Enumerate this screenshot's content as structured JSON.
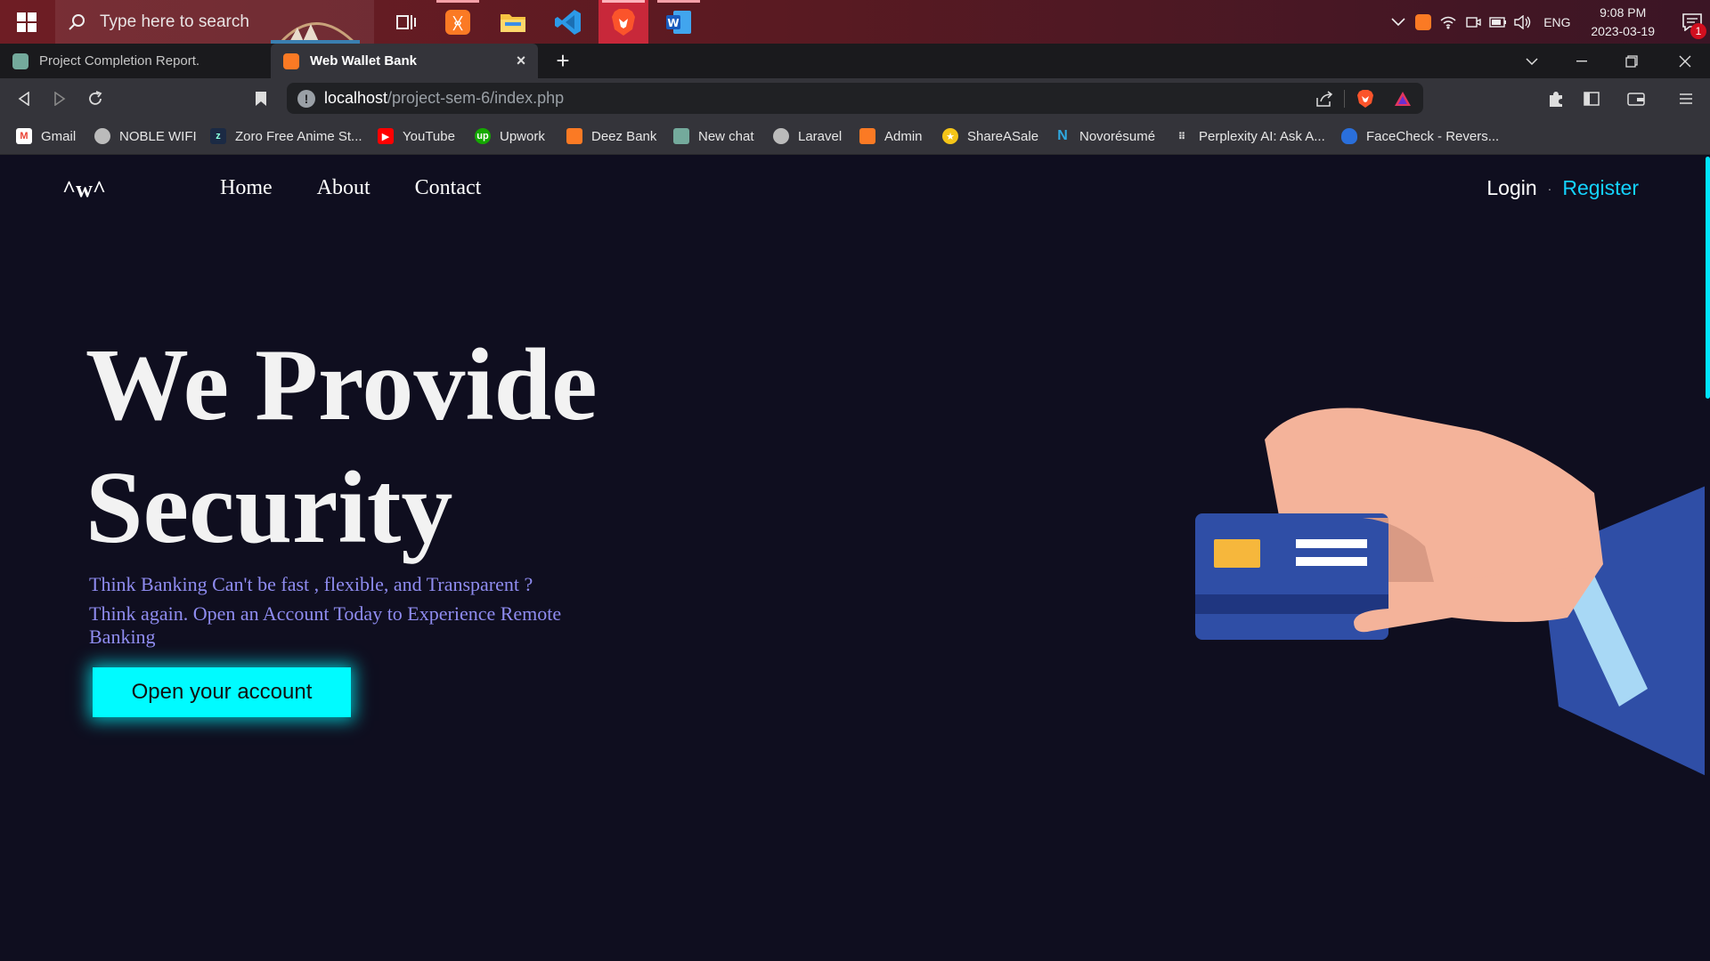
{
  "taskbar": {
    "search_placeholder": "Type here to search",
    "language": "ENG",
    "time": "9:08 PM",
    "date": "2023-03-19",
    "notification_count": "1"
  },
  "browser": {
    "tabs": [
      {
        "title": "Project Completion Report."
      },
      {
        "title": "Web Wallet Bank"
      }
    ],
    "url_host": "localhost",
    "url_path": "/project-sem-6/index.php",
    "bookmarks": [
      {
        "label": "Gmail"
      },
      {
        "label": "NOBLE WIFI"
      },
      {
        "label": "Zoro Free Anime St..."
      },
      {
        "label": "YouTube"
      },
      {
        "label": "Upwork"
      },
      {
        "label": "Deez Bank"
      },
      {
        "label": "New chat"
      },
      {
        "label": "Laravel"
      },
      {
        "label": "Admin"
      },
      {
        "label": "ShareASale"
      },
      {
        "label": "Novorésumé"
      },
      {
        "label": "Perplexity AI: Ask A..."
      },
      {
        "label": "FaceCheck - Revers..."
      }
    ]
  },
  "site": {
    "logo": "^w^",
    "nav": [
      "Home",
      "About",
      "Contact"
    ],
    "login": "Login",
    "separator": "·",
    "register": "Register",
    "hero_line1": "We Provide",
    "hero_line2": "Security",
    "subtitle1": "Think Banking Can't be fast , flexible, and Transparent ?",
    "subtitle2": "Think again. Open an Account Today to Experience Remote Banking",
    "cta": "Open your account"
  },
  "colors": {
    "page_bg": "#0f0e1f",
    "accent": "#00fbff",
    "register": "#14d3ff",
    "subtitle": "#8f8cf0"
  }
}
